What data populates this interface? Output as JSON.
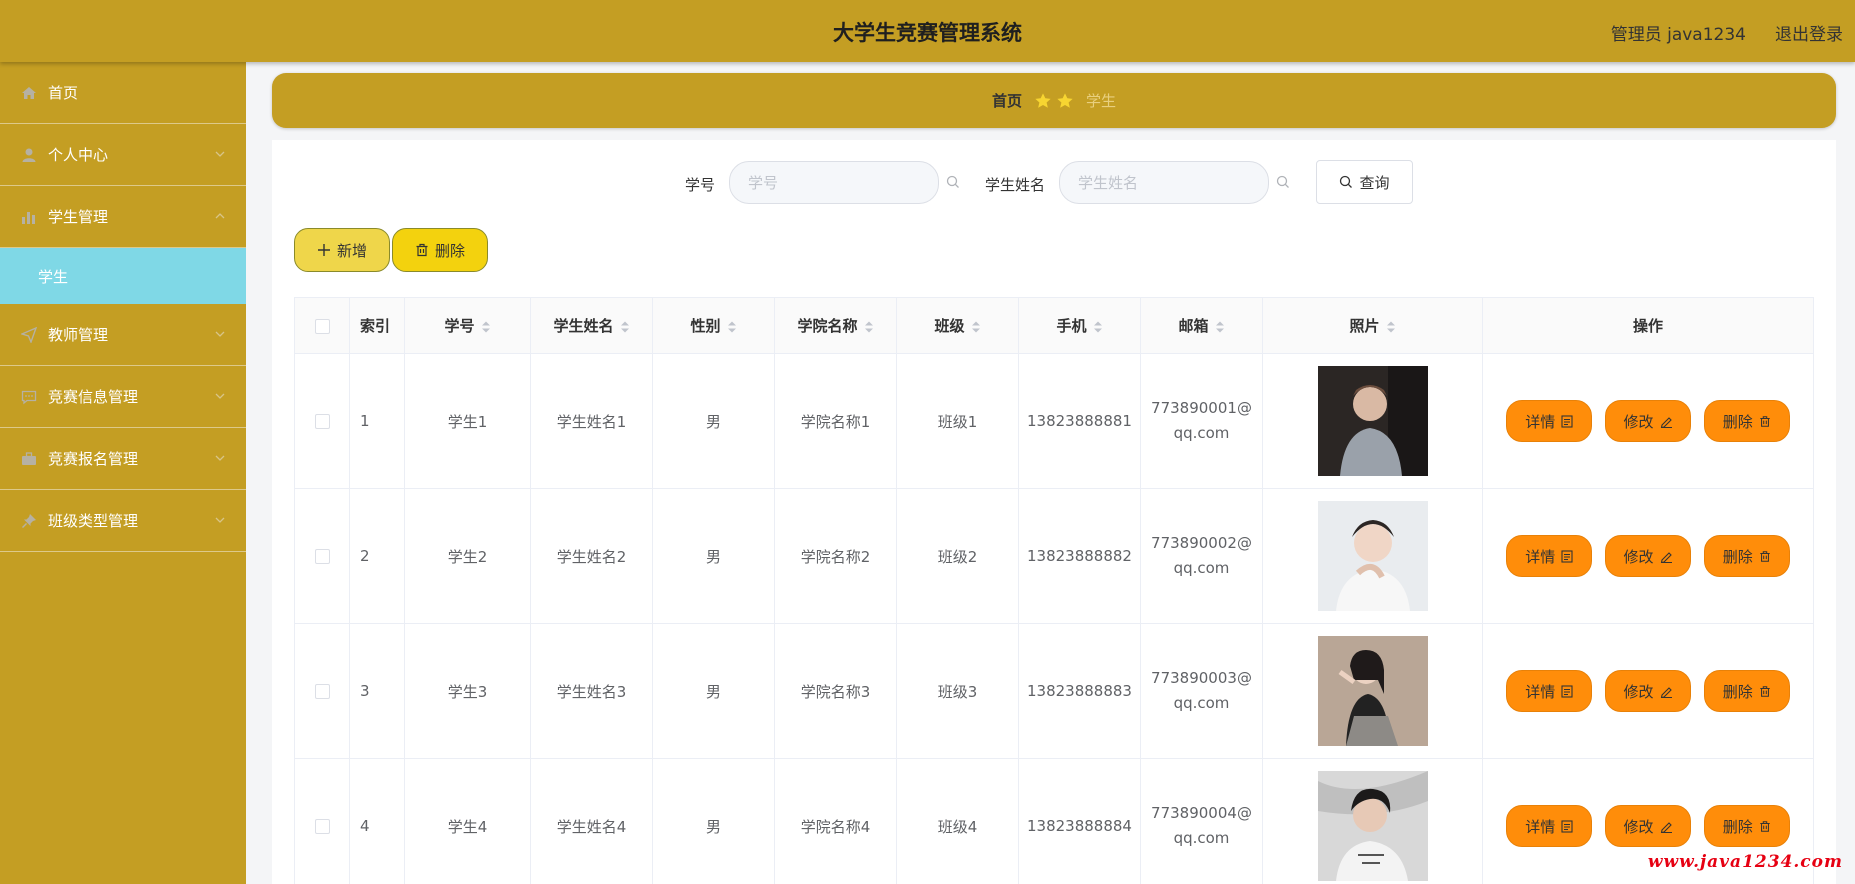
{
  "header": {
    "title": "大学生竞赛管理系统",
    "user": "管理员 java1234",
    "logout": "退出登录"
  },
  "sidebar": {
    "items": [
      {
        "label": "首页",
        "icon": "home-icon"
      },
      {
        "label": "个人中心",
        "icon": "user-icon"
      },
      {
        "label": "学生管理",
        "icon": "chart-icon",
        "expanded": true,
        "children": [
          {
            "label": "学生"
          }
        ]
      },
      {
        "label": "教师管理",
        "icon": "send-icon"
      },
      {
        "label": "竞赛信息管理",
        "icon": "message-icon"
      },
      {
        "label": "竞赛报名管理",
        "icon": "briefcase-icon"
      },
      {
        "label": "班级类型管理",
        "icon": "pin-icon"
      }
    ]
  },
  "breadcrumb": {
    "home": "首页",
    "current": "学生"
  },
  "search": {
    "fields": [
      {
        "label": "学号",
        "placeholder": "学号"
      },
      {
        "label": "学生姓名",
        "placeholder": "学生姓名"
      }
    ],
    "query_label": "查询"
  },
  "actions": {
    "add_label": "新增",
    "delete_label": "删除"
  },
  "table": {
    "columns": [
      "索引",
      "学号",
      "学生姓名",
      "性别",
      "学院名称",
      "班级",
      "手机",
      "邮箱",
      "照片",
      "操作"
    ],
    "rows": [
      {
        "index": "1",
        "id": "学生1",
        "name": "学生姓名1",
        "gender": "男",
        "college": "学院名称1",
        "class": "班级1",
        "phone": "13823888881",
        "email_a": "773890001@",
        "email_b": "qq.com"
      },
      {
        "index": "2",
        "id": "学生2",
        "name": "学生姓名2",
        "gender": "男",
        "college": "学院名称2",
        "class": "班级2",
        "phone": "13823888882",
        "email_a": "773890002@",
        "email_b": "qq.com"
      },
      {
        "index": "3",
        "id": "学生3",
        "name": "学生姓名3",
        "gender": "男",
        "college": "学院名称3",
        "class": "班级3",
        "phone": "13823888883",
        "email_a": "773890003@",
        "email_b": "qq.com"
      },
      {
        "index": "4",
        "id": "学生4",
        "name": "学生姓名4",
        "gender": "男",
        "college": "学院名称4",
        "class": "班级4",
        "phone": "13823888884",
        "email_a": "773890004@",
        "email_b": "qq.com"
      }
    ],
    "ops": {
      "detail": "详情",
      "edit": "修改",
      "delete": "删除"
    }
  },
  "watermark": "www.java1234.com",
  "colors": {
    "theme": "#c49e23",
    "active_submenu": "#7fd8e6",
    "op_button": "#ff8d0a"
  }
}
